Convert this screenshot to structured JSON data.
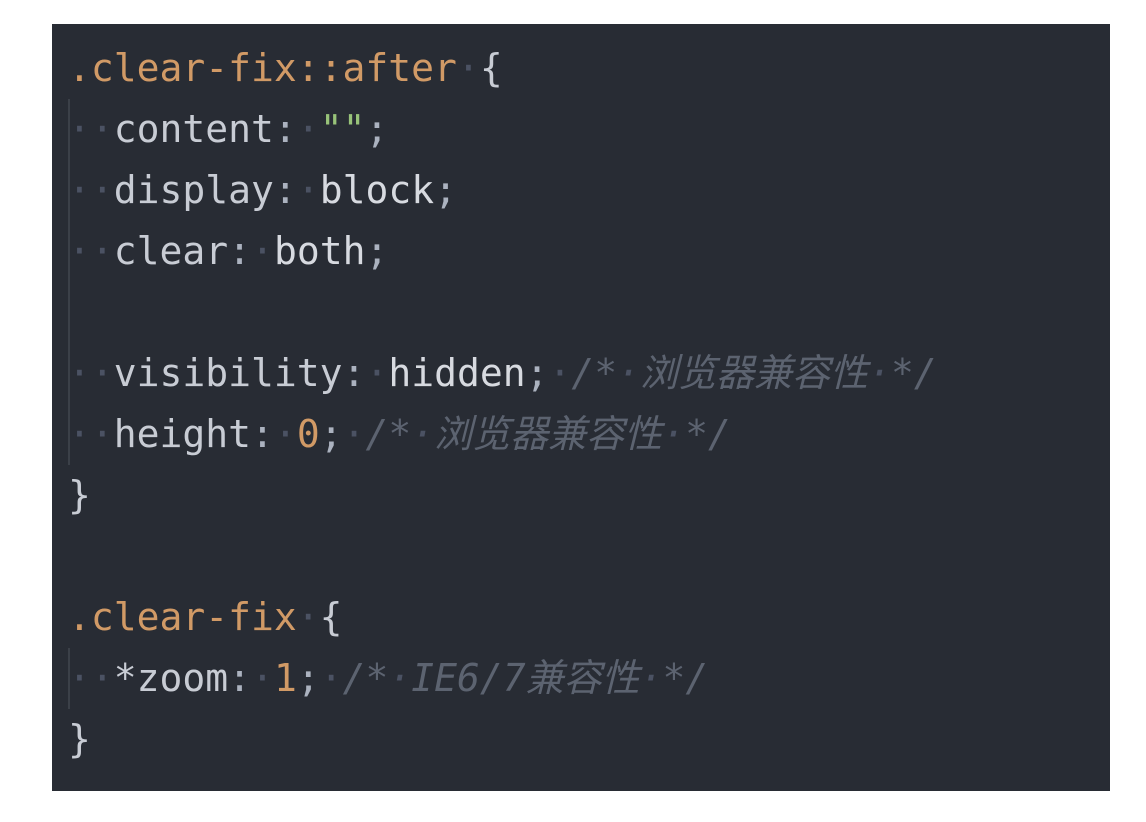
{
  "editor": {
    "theme_colors": {
      "background": "#282c34",
      "selector": "#d19a66",
      "string": "#98c379",
      "number": "#d19a66",
      "comment": "#5c6370",
      "whitespace_marker": "#4b5263"
    },
    "code": {
      "rule1_selector": ".clear-fix::after",
      "open_brace": "{",
      "close_brace": "}",
      "content_prop": "content",
      "content_value": "\"\"",
      "display_prop": "display",
      "display_value": "block",
      "clear_prop": "clear",
      "clear_value": "both",
      "visibility_prop": "visibility",
      "visibility_value": "hidden",
      "visibility_comment": "浏览器兼容性",
      "height_prop": "height",
      "height_value": "0",
      "height_comment": "浏览器兼容性",
      "rule2_selector": ".clear-fix",
      "zoom_prop": "*zoom",
      "zoom_value": "1",
      "zoom_comment": "IE6/7兼容性"
    }
  }
}
